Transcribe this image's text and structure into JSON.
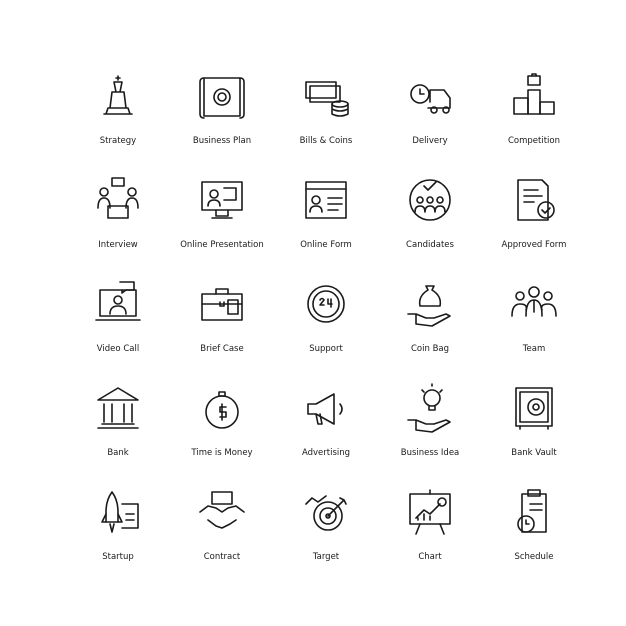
{
  "icons": [
    {
      "label": "Strategy",
      "icon": "chess-icon"
    },
    {
      "label": "Business Plan",
      "icon": "blueprint-gear-icon"
    },
    {
      "label": "Bills & Coins",
      "icon": "bills-coins-icon"
    },
    {
      "label": "Delivery",
      "icon": "delivery-truck-icon"
    },
    {
      "label": "Competition",
      "icon": "podium-icon"
    },
    {
      "label": "Interview",
      "icon": "interview-icon"
    },
    {
      "label": "Online Presentation",
      "icon": "monitor-presentation-icon"
    },
    {
      "label": "Online Form",
      "icon": "web-form-icon"
    },
    {
      "label": "Candidates",
      "icon": "candidates-icon"
    },
    {
      "label": "Approved Form",
      "icon": "approved-form-icon"
    },
    {
      "label": "Video Call",
      "icon": "video-call-icon"
    },
    {
      "label": "Brief Case",
      "icon": "briefcase-icon"
    },
    {
      "label": "Support",
      "icon": "support-24-icon"
    },
    {
      "label": "Coin Bag",
      "icon": "coin-bag-hand-icon"
    },
    {
      "label": "Team",
      "icon": "team-icon"
    },
    {
      "label": "Bank",
      "icon": "bank-icon"
    },
    {
      "label": "Time is Money",
      "icon": "stopwatch-dollar-icon"
    },
    {
      "label": "Advertising",
      "icon": "megaphone-icon"
    },
    {
      "label": "Business Idea",
      "icon": "bulb-hand-icon"
    },
    {
      "label": "Bank Vault",
      "icon": "vault-icon"
    },
    {
      "label": "Startup",
      "icon": "rocket-icon"
    },
    {
      "label": "Contract",
      "icon": "handshake-icon"
    },
    {
      "label": "Target",
      "icon": "target-icon"
    },
    {
      "label": "Chart",
      "icon": "chart-board-icon"
    },
    {
      "label": "Schedule",
      "icon": "clipboard-clock-icon"
    }
  ]
}
